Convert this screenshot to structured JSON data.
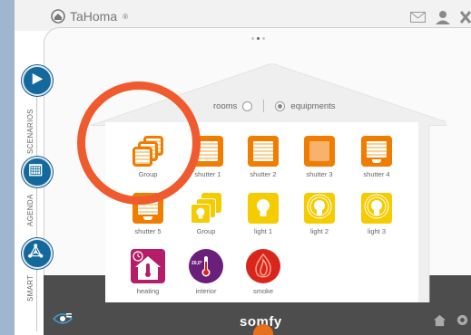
{
  "app": {
    "brand": "TaHoma",
    "brand_mark": "®",
    "footer_brand": "somfy"
  },
  "sidebar": {
    "items": [
      {
        "label": "SCENARIOS",
        "icon": "play-icon"
      },
      {
        "label": "AGENDA",
        "icon": "calendar-icon"
      },
      {
        "label": "SMART",
        "icon": "network-icon"
      }
    ]
  },
  "view_toggle": {
    "rooms": "rooms",
    "equipments": "equipments",
    "selected": "equipments"
  },
  "devices": [
    {
      "label": "Group",
      "icon": "group-shutter-icon"
    },
    {
      "label": "shutter 1",
      "icon": "shutter-icon"
    },
    {
      "label": "shutter 2",
      "icon": "shutter-icon"
    },
    {
      "label": "shutter 3",
      "icon": "shutter-solid-icon"
    },
    {
      "label": "shutter 4",
      "icon": "shutter-flap-icon"
    },
    {
      "label": "shutter 5",
      "icon": "shutter-flap-icon"
    },
    {
      "label": "Group",
      "icon": "group-light-icon"
    },
    {
      "label": "light 1",
      "icon": "light-icon"
    },
    {
      "label": "light 2",
      "icon": "light-on-icon"
    },
    {
      "label": "light 3",
      "icon": "light-on-icon"
    },
    {
      "label": "heating",
      "icon": "heating-icon"
    },
    {
      "label": "interior",
      "icon": "thermometer-icon",
      "value": "20,0°"
    },
    {
      "label": "smoke",
      "icon": "smoke-icon"
    }
  ],
  "colors": {
    "accent": "#f07d00",
    "sidebar": "#13699b",
    "annotation": "#ef5a2e",
    "footer": "#4d4d4d",
    "light": "#f5cc00",
    "heating": "#b51d69",
    "interior": "#6a1f7a",
    "smoke": "#d9261c"
  }
}
